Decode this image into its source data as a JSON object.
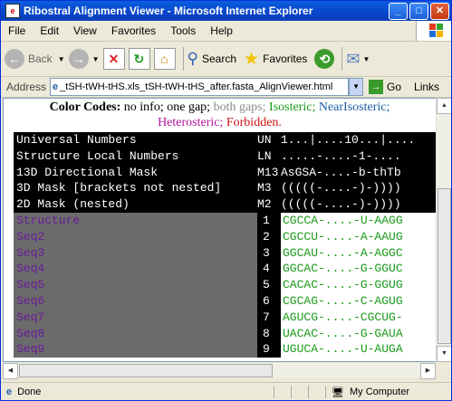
{
  "window": {
    "title": "Ribostral Alignment Viewer - Microsoft Internet Explorer"
  },
  "menu": [
    "File",
    "Edit",
    "View",
    "Favorites",
    "Tools",
    "Help"
  ],
  "toolbar": {
    "back": "Back",
    "search": "Search",
    "favorites": "Favorites"
  },
  "address": {
    "label": "Address",
    "value": "_tSH-tWH-tHS.xls_tSH-tWH-tHS_after.fasta_AlignViewer.html",
    "go": "Go",
    "links": "Links"
  },
  "legend": {
    "title": "Color Codes:",
    "items": [
      {
        "text": "no info;",
        "color": "#000000"
      },
      {
        "text": "one gap;",
        "color": "#000000"
      },
      {
        "text": "both gaps;",
        "color": "#8a8a8a"
      },
      {
        "text": "Isosteric;",
        "color": "#1a9b1a"
      },
      {
        "text": "NearIsosteric;",
        "color": "#1f5fa8"
      },
      {
        "text": "Heterosteric;",
        "color": "#b0149a"
      },
      {
        "text": "Forbidden.",
        "color": "#cc1111"
      }
    ]
  },
  "header_rows": [
    {
      "label": "Universal Numbers",
      "code": "UN",
      "seq": "1...|....10...|...."
    },
    {
      "label": "Structure Local Numbers",
      "code": "LN",
      "seq": ".....-....-1-...."
    },
    {
      "label": "13D Directional Mask",
      "code": "M13",
      "seq": "AsGSA-....-b-thTb"
    },
    {
      "label": "3D Mask [brackets not nested]",
      "code": "M3",
      "seq": "(((((-....-)-))))"
    },
    {
      "label": "2D Mask (nested)",
      "code": "M2",
      "seq": "(((((-....-)-))))"
    }
  ],
  "data_rows": [
    {
      "label": "Structure",
      "code": "1",
      "seq": "CGCCA-....-U-AAGG"
    },
    {
      "label": "Seq2",
      "code": "2",
      "seq": "CGCCU-....-A-AAUG"
    },
    {
      "label": "Seq3",
      "code": "3",
      "seq": "GGCAU-....-A-AGGC"
    },
    {
      "label": "Seq4",
      "code": "4",
      "seq": "GGCAC-....-G-GGUC"
    },
    {
      "label": "Seq5",
      "code": "5",
      "seq": "CACAC-....-G-GGUG"
    },
    {
      "label": "Seq6",
      "code": "6",
      "seq": "CGCAG-....-C-AGUG"
    },
    {
      "label": "Seq7",
      "code": "7",
      "seq": "AGUCG-....-CGCUG-"
    },
    {
      "label": "Seq8",
      "code": "8",
      "seq": "UACAC-....-G-GAUA"
    },
    {
      "label": "Seq9",
      "code": "9",
      "seq": "UGUCA-....-U-AUGA"
    }
  ],
  "status": {
    "left": "Done",
    "right": "My Computer"
  }
}
